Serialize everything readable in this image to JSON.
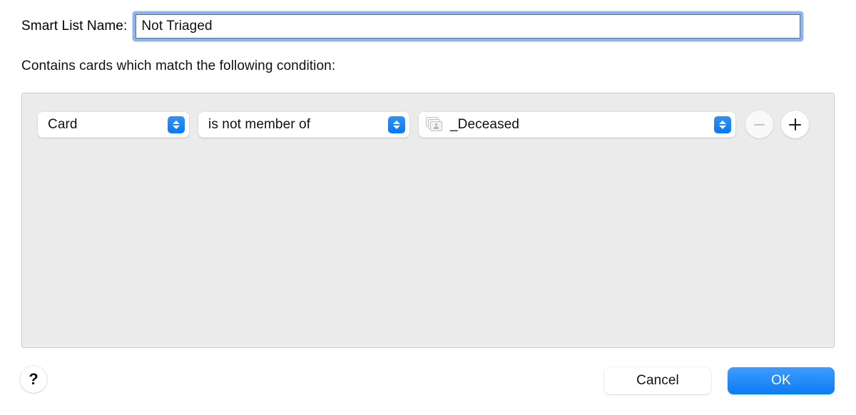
{
  "dialog": {
    "name_label": "Smart List Name:",
    "name_value": "Not Triaged",
    "name_placeholder": "Smart List Name",
    "description": "Contains cards which match the following condition:"
  },
  "condition": {
    "field": {
      "label": "Card",
      "chevron_icon": "chevron-up-down-icon"
    },
    "operator": {
      "label": "is not member of",
      "chevron_icon": "chevron-up-down-icon"
    },
    "value": {
      "label": "_Deceased",
      "icon": "stacked-cards-icon",
      "chevron_icon": "chevron-up-down-icon"
    },
    "remove_button": {
      "icon": "minus-icon",
      "enabled": false
    },
    "add_button": {
      "icon": "plus-icon",
      "enabled": true
    }
  },
  "footer": {
    "help_label": "?",
    "cancel_label": "Cancel",
    "ok_label": "OK"
  },
  "colors": {
    "accent": "#0b7cf4",
    "focus_ring": "#8cb4f5",
    "panel_background": "#ebebeb",
    "panel_border": "#c9c9c9"
  }
}
